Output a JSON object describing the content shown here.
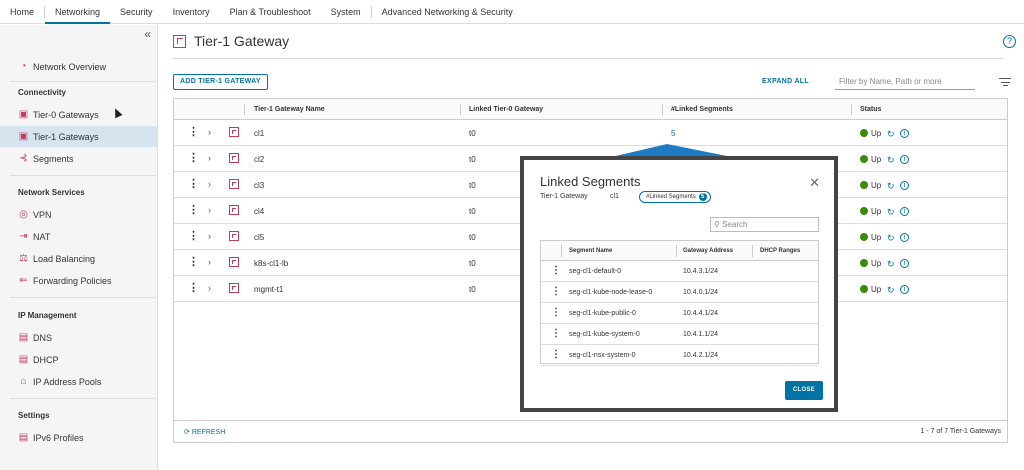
{
  "topnav": [
    "Home",
    "Networking",
    "Security",
    "Inventory",
    "Plan & Troubleshoot",
    "System",
    "Advanced Networking & Security"
  ],
  "sidebar": {
    "overview": "Network Overview",
    "connectivity_header": "Connectivity",
    "tier0": "Tier-0 Gateways",
    "tier1": "Tier-1 Gateways",
    "segments": "Segments",
    "services_header": "Network Services",
    "vpn": "VPN",
    "nat": "NAT",
    "lb": "Load Balancing",
    "fwd": "Forwarding Policies",
    "ipm_header": "IP Management",
    "dns": "DNS",
    "dhcp": "DHCP",
    "pools": "IP Address Pools",
    "settings_header": "Settings",
    "ipv6": "IPv6 Profiles"
  },
  "page": {
    "title": "Tier-1 Gateway",
    "help": "?",
    "add_button": "ADD TIER-1 GATEWAY",
    "expand_all": "EXPAND ALL",
    "filter_placeholder": "Filter by Name, Path or more",
    "columns": [
      "Tier-1 Gateway Name",
      "Linked Tier-0 Gateway",
      "#Linked Segments",
      "Status"
    ],
    "rows": [
      {
        "name": "cl1",
        "t0": "t0",
        "segs": "5",
        "status": "Up"
      },
      {
        "name": "cl2",
        "t0": "t0",
        "segs": "",
        "status": "Up"
      },
      {
        "name": "cl3",
        "t0": "t0",
        "segs": "",
        "status": "Up"
      },
      {
        "name": "cl4",
        "t0": "t0",
        "segs": "",
        "status": "Up"
      },
      {
        "name": "cl5",
        "t0": "t0",
        "segs": "",
        "status": "Up"
      },
      {
        "name": "k8s-cl1-lb",
        "t0": "t0",
        "segs": "",
        "status": "Up"
      },
      {
        "name": "mgmt-t1",
        "t0": "t0",
        "segs": "",
        "status": "Up"
      }
    ],
    "refresh": "REFRESH",
    "count": "1 - 7 of 7 Tier-1 Gateways"
  },
  "modal": {
    "title": "Linked Segments",
    "gw_label": "Tier-1 Gateway",
    "gw_value": "cl1",
    "badge_label": "#Linked Segments",
    "badge_count": "5",
    "search_placeholder": "Search",
    "columns": [
      "Segment Name",
      "Gateway Address",
      "DHCP Ranges"
    ],
    "rows": [
      {
        "name": "seg-cl1-default-0",
        "gw": "10.4.3.1/24"
      },
      {
        "name": "seg-cl1-kube-node-lease-0",
        "gw": "10.4.0.1/24"
      },
      {
        "name": "seg-cl1-kube-public-0",
        "gw": "10.4.4.1/24"
      },
      {
        "name": "seg-cl1-kube-system-0",
        "gw": "10.4.1.1/24"
      },
      {
        "name": "seg-cl1-nsx-system-0",
        "gw": "10.4.2.1/24"
      }
    ],
    "close": "CLOSE"
  }
}
